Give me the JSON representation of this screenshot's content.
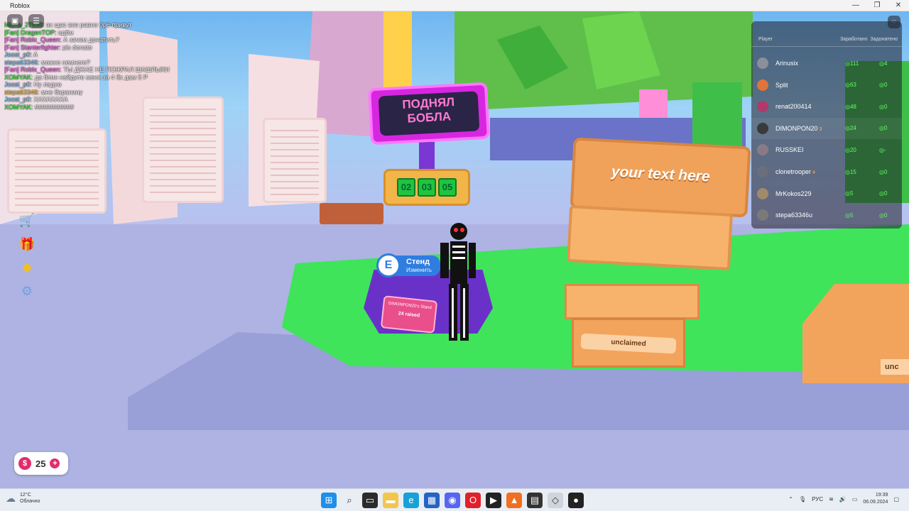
{
  "window": {
    "title": "Roblox",
    "minimize": "—",
    "maximize": "❐",
    "close": "✕"
  },
  "chat": [
    {
      "name": "Micha_27638:",
      "text": " эх щас все равно 0р6 привут",
      "cls": ""
    },
    {
      "name": "[Fan] DragenTOP:",
      "text": " идём",
      "cls": ""
    },
    {
      "name": "[Fan] Roblx_Queen:",
      "text": " А зачем донатить?",
      "cls": "c2"
    },
    {
      "name": "[Fan] Stanterfighter:",
      "text": " pls donate",
      "cls": "c2"
    },
    {
      "name": "Joost_p0:",
      "text": " A",
      "cls": "c3"
    },
    {
      "name": "stepa63346:",
      "text": " можно немного?",
      "cls": "c3"
    },
    {
      "name": "[Fan] Roblx_Queen:",
      "text": " ТЫ ДЖАЕ НЕ ПОЖРАЛ ШАШЛЫКИ",
      "cls": "c2"
    },
    {
      "name": "XOMYAK:",
      "text": " да блин найдите меня за 4 бх дам 5 Р",
      "cls": ""
    },
    {
      "name": "Joost_p0:",
      "text": " Ну ладно",
      "cls": "c3"
    },
    {
      "name": "stepa63346:",
      "text": " мне баранину",
      "cls": "c4"
    },
    {
      "name": "Joost_p0:",
      "text": " ХАХАХАХА",
      "cls": "c3"
    },
    {
      "name": "XOMYAK:",
      "text": " ###########",
      "cls": ""
    }
  ],
  "booth": {
    "sign_line1": "ПОДНЯЛ",
    "sign_line2": "БОБЛА",
    "digits": [
      "02",
      "03",
      "05"
    ],
    "owner": "DIMONPON20's Stand",
    "raised": "24 raised"
  },
  "prompt": {
    "key": "E",
    "action": "Стенд",
    "sub": "Изменить"
  },
  "stand": {
    "sign_text": "your text here",
    "label": "unclaimed",
    "right_label": "unc"
  },
  "leaderboard": {
    "header_player": "Player",
    "header_earned": "Заработано",
    "header_donated": "Задонатено",
    "rows": [
      {
        "name": "Arinusix",
        "badge": "",
        "earned": "111",
        "donated": "4",
        "avatar": "#8a8f9a"
      },
      {
        "name": "Split",
        "badge": "",
        "earned": "63",
        "donated": "0",
        "avatar": "#e0743a"
      },
      {
        "name": "renat200414",
        "badge": "",
        "earned": "48",
        "donated": "0",
        "avatar": "#b03a6a"
      },
      {
        "name": "DIMONPON20",
        "badge": "3",
        "earned": "24",
        "donated": "0",
        "avatar": "#3a3a3a"
      },
      {
        "name": "RUSSKEI",
        "badge": "",
        "earned": "20",
        "donated": "-",
        "avatar": "#8a7a88"
      },
      {
        "name": "clonetrooper",
        "badge": "4",
        "earned": "15",
        "donated": "0",
        "avatar": "#6a6f7a"
      },
      {
        "name": "MrKokos229",
        "badge": "",
        "earned": "5",
        "donated": "0",
        "avatar": "#a08a6a"
      },
      {
        "name": "stepa63346u",
        "badge": "",
        "earned": "5",
        "donated": "0",
        "avatar": "#7a7a7a"
      }
    ]
  },
  "currency": {
    "symbol": "$",
    "amount": "25",
    "plus": "+"
  },
  "taskbar": {
    "weather_temp": "12°C",
    "weather_desc": "Облачно",
    "lang": "РУС",
    "time": "19:39",
    "date": "06.09.2024"
  }
}
